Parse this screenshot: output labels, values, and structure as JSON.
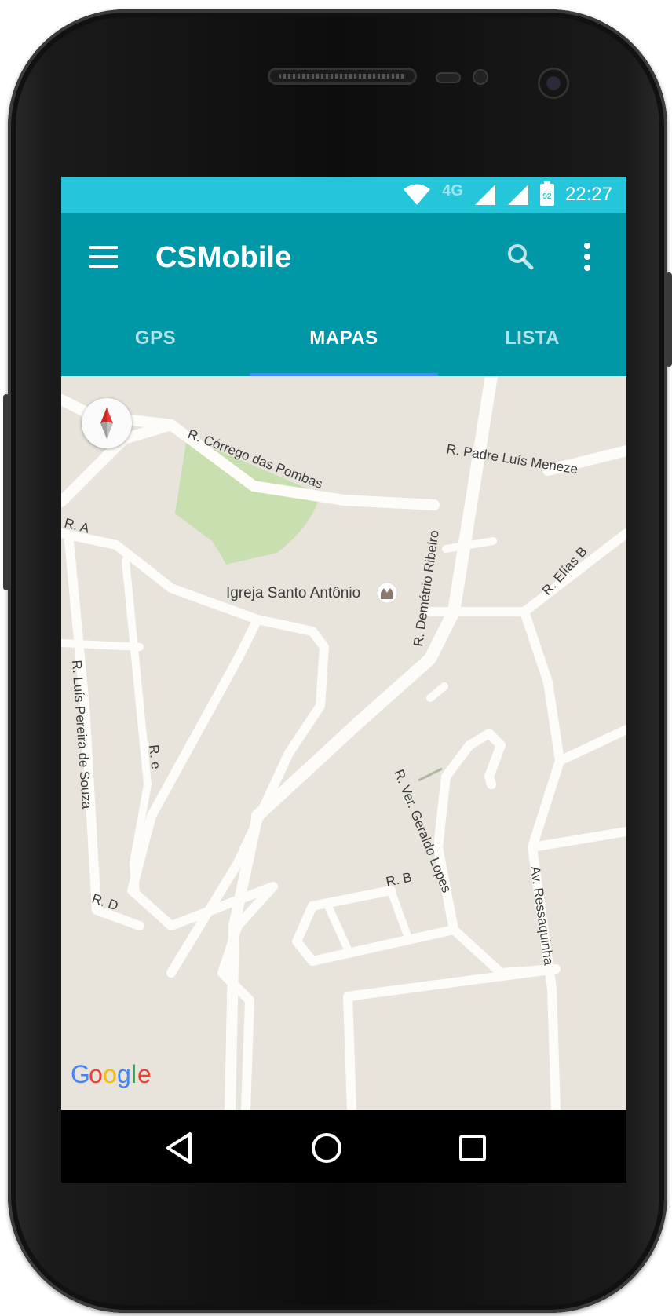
{
  "statusbar": {
    "network_label": "4G",
    "battery_level": "92",
    "time": "22:27"
  },
  "appbar": {
    "title": "CSMobile",
    "menu_icon": "hamburger-menu-icon",
    "search_icon": "search-icon",
    "more_icon": "more-vert-icon"
  },
  "tabs": [
    {
      "label": "GPS",
      "active": false
    },
    {
      "label": "MAPAS",
      "active": true
    },
    {
      "label": "LISTA",
      "active": false
    }
  ],
  "map": {
    "labels": {
      "corrego": "R. Córrego das Pombas",
      "padre": "R. Padre Luís Meneze",
      "ra": "R. A",
      "elias": "R. Elías B",
      "igreja": "Igreja Santo Antônio",
      "demetrio": "R. Demétrio Ribeiro",
      "luis": "R. Luís Pereira de Souza",
      "re": "R. e",
      "vereador": "R. Ver. Geraldo Lopes",
      "rb": "R. B",
      "rd": "R. D",
      "ressaquinha": "Av. Ressaquinha"
    },
    "attribution": "Google",
    "colors": {
      "land": "#e8e4dc",
      "road": "#fdfcf9",
      "park": "#c8dfb0",
      "label": "#3c3c3c"
    }
  },
  "navbar": {
    "back_icon": "back-triangle-icon",
    "home_icon": "home-circle-icon",
    "recents_icon": "recents-square-icon"
  },
  "colors": {
    "statusbar": "#26c6da",
    "appbar": "#0097a7",
    "tab_indicator": "#448aff"
  }
}
